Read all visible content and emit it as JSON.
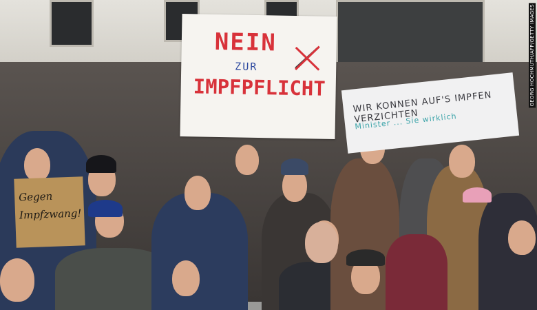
{
  "photo": {
    "main_sign": {
      "line1": "NEIN",
      "line2": "ZUR",
      "line3": "IMPFPFLICHT",
      "accent_color": "#d8323a"
    },
    "banner": {
      "text": "WIR KONNEN AUF'S IMPFEN VERZICHTEN",
      "subtext": "Minister ... Sie wirklich"
    },
    "cardboard_sign": {
      "line1": "Gegen",
      "line2": "Impfzwang!"
    },
    "credit": "GEORG HOCHMUTH/AFP/GETTY IMAGES"
  }
}
